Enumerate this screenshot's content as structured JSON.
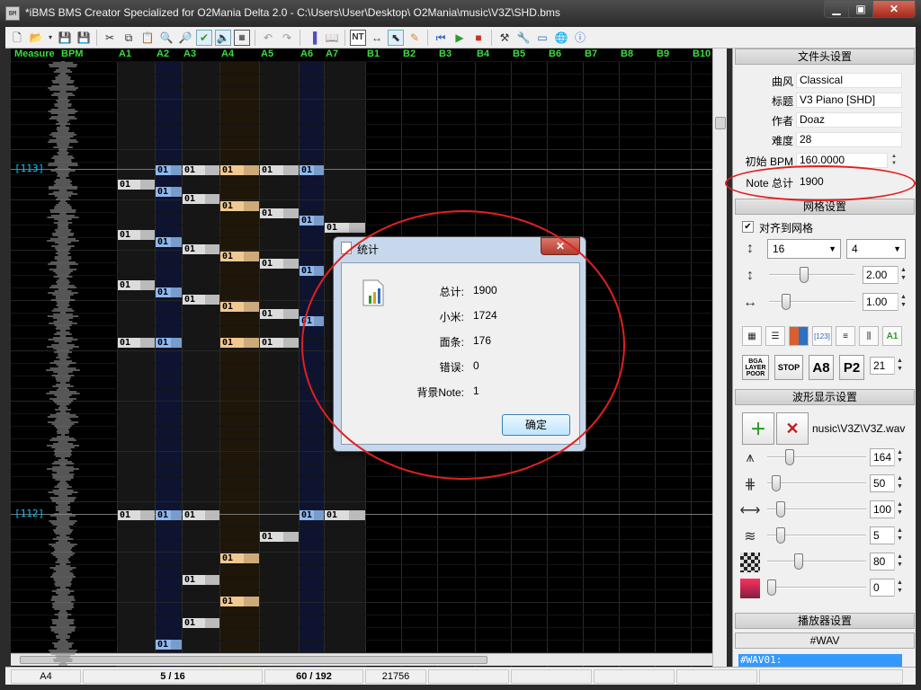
{
  "window": {
    "app_icon": "BM",
    "title": "*iBMS BMS Creator Specialized for O2Mania Delta 2.0 - C:\\Users\\User\\Desktop\\                                              O2Mania\\music\\V3Z\\SHD.bms",
    "minimize": "▁",
    "maximize": "▣",
    "close": "✕"
  },
  "toolbar": {
    "icons": [
      "new-file-icon",
      "open-folder-icon",
      "dropdown-arrow-icon",
      "save-icon",
      "save-as-icon",
      "cut-icon",
      "copy-icon",
      "paste-icon",
      "find-icon",
      "find-next-icon",
      "check-icon",
      "speaker-icon",
      "preview-icon",
      "undo-icon",
      "redo-icon",
      "column-icon",
      "book-icon",
      "nt-mode-icon",
      "measure-icon",
      "pointer-icon",
      "pencil-icon",
      "play-start-icon",
      "play-icon",
      "stop-icon",
      "tools-icon",
      "wrench-icon",
      "view-icon",
      "globe-icon",
      "info-icon"
    ],
    "nt_label": "NT"
  },
  "editor": {
    "header": {
      "measure": "Measure",
      "bpm": "BPM",
      "columns": [
        "A1",
        "A2",
        "A3",
        "A4",
        "A5",
        "A6",
        "A7",
        "B1",
        "B2",
        "B3",
        "B4",
        "B5",
        "B6",
        "B7",
        "B8",
        "B9",
        "B10"
      ]
    },
    "measures": [
      "[113]",
      "[112]"
    ],
    "note_text": "01"
  },
  "dialog": {
    "title": "统计",
    "rows": [
      {
        "label": "总计:",
        "value": "1900"
      },
      {
        "label": "小米:",
        "value": "1724"
      },
      {
        "label": "面条:",
        "value": "176"
      },
      {
        "label": "错误:",
        "value": "0"
      },
      {
        "label": "背景Note:",
        "value": "1"
      }
    ],
    "ok": "确定",
    "close": "✕"
  },
  "panel": {
    "header_section": "文件头设置",
    "fields": [
      {
        "label": "曲风",
        "value": "Classical"
      },
      {
        "label": "标题",
        "value": "V3 Piano [SHD]"
      },
      {
        "label": "作者",
        "value": "Doaz"
      },
      {
        "label": "难度",
        "value": "28"
      },
      {
        "label": "初始 BPM",
        "value": "160.0000"
      },
      {
        "label": "Note 总计",
        "value": "1900"
      }
    ],
    "grid_section": "网格设置",
    "snap_label": "对齐到网格",
    "snap_checked": true,
    "grid_div": "16",
    "grid_sub": "4",
    "vspacing": "2.00",
    "hspacing": "1.00",
    "vspacing_level": 0.35,
    "hspacing_level": 0.15,
    "grid_icons": [
      "grid-icon",
      "lines-icon",
      "color-icon",
      "number-123-icon",
      "rows-icon",
      "columns-icon",
      "a1-icon"
    ],
    "bga_btn": "BGA\nLAYER\nPOOR",
    "stop_btn": "STOP",
    "a8_btn": "A8",
    "p2_btn": "P2",
    "offset": "21",
    "wave_section": "波形显示设置",
    "wave_file": "nusic\\V3Z\\V3Z.wav",
    "wave_sliders": [
      {
        "icon": "wave-height-icon",
        "value": "164",
        "level": 0.2
      },
      {
        "icon": "wave-offset-icon",
        "value": "50",
        "level": 0.05
      },
      {
        "icon": "wave-width-icon",
        "value": "100",
        "level": 0.1
      },
      {
        "icon": "wave-precision-icon",
        "value": "5",
        "level": 0.1
      },
      {
        "icon": "transparency-icon",
        "value": "80",
        "level": 0.3
      },
      {
        "icon": "color-gradient-icon",
        "value": "0",
        "level": 0.0
      }
    ],
    "player_section": "播放器设置",
    "wav_section": "#WAV",
    "wav_item": "#WAV01:"
  },
  "status": {
    "column": "A4",
    "grid": "5 / 16",
    "position": "60 / 192",
    "time": "21756"
  },
  "colors": {
    "annotation": "#e02020",
    "note_white": "#dcdcdc",
    "note_blue": "#8fb8ee",
    "note_gold": "#f0c890",
    "header_green": "#3cdc3c",
    "measure_cyan": "#00c8ff"
  }
}
